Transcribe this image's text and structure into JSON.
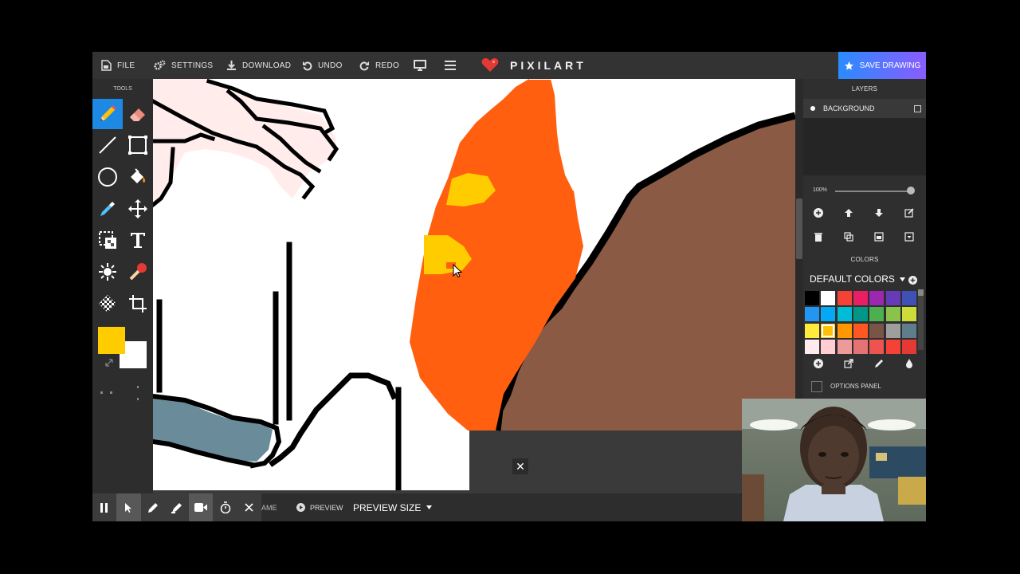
{
  "menu": {
    "file": "FILE",
    "settings": "SETTINGS",
    "download": "DOWNLOAD",
    "undo": "UNDO",
    "redo": "REDO"
  },
  "logo_text": "PIXILART",
  "save_button": "SAVE DRAWING",
  "tools_title": "TOOLS",
  "layers": {
    "title": "LAYERS",
    "items": [
      {
        "name": "BACKGROUND"
      }
    ],
    "opacity": "100%"
  },
  "colors": {
    "title": "COLORS",
    "palette_name": "DEFAULT COLORS",
    "rows": [
      [
        "#000000",
        "#ffffff",
        "#f44336",
        "#e91e63",
        "#9c27b0",
        "#673ab7",
        "#3f51b5"
      ],
      [
        "#2196f3",
        "#03a9f4",
        "#00bcd4",
        "#009688",
        "#4caf50",
        "#8bc34a",
        "#cddc39"
      ],
      [
        "#ffeb3b",
        "#ffc107",
        "#ff9800",
        "#ff5722",
        "#795548",
        "#9e9e9e",
        "#607d8b"
      ],
      [
        "#ffebee",
        "#ffcdd2",
        "#ef9a9a",
        "#e57373",
        "#ef5350",
        "#f44336",
        "#e53935"
      ]
    ],
    "selected": "#ffc107"
  },
  "options_panel_label": "OPTIONS PANEL",
  "primary_color": "#ffcc00",
  "secondary_color": "#ffffff",
  "bottom": {
    "frame_fragment": "AME",
    "preview": "PREVIEW",
    "preview_size": "PREVIEW SIZE"
  },
  "accent_colors": {
    "save_gradient_start": "#2a8cff",
    "save_gradient_end": "#8a5cff",
    "active_tool": "#1e88e5"
  }
}
